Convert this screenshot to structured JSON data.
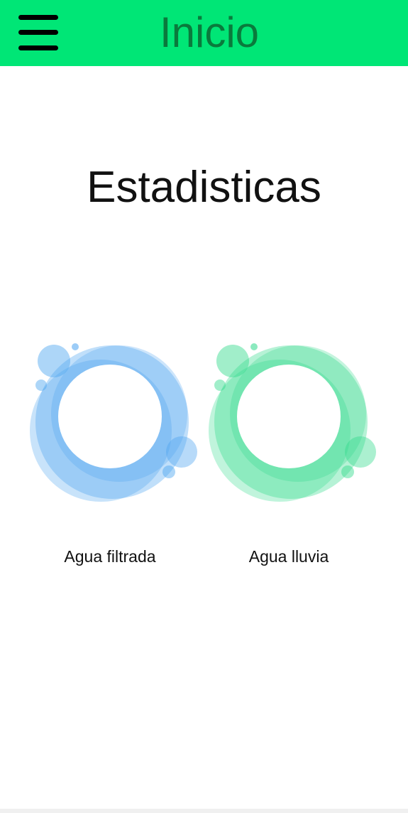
{
  "header": {
    "title": "Inicio",
    "menu_icon": "hamburger-menu-icon",
    "background_color": "#00e676",
    "title_color": "#0a7a3c"
  },
  "main": {
    "heading": "Estadisticas",
    "cards": [
      {
        "label": "Agua filtrada",
        "icon": "water-ring-icon",
        "color": "#4aa3f0"
      },
      {
        "label": "Agua lluvia",
        "icon": "water-ring-icon",
        "color": "#2ed98a"
      }
    ]
  }
}
